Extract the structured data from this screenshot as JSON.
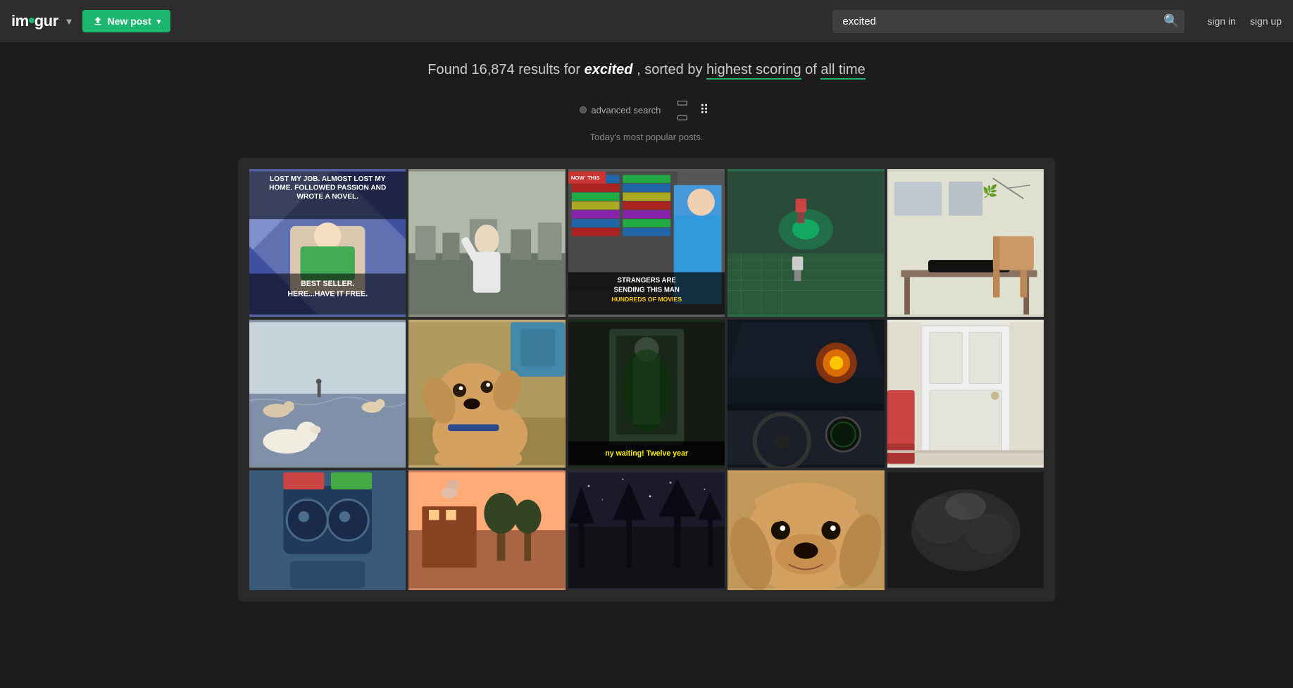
{
  "header": {
    "logo": "imgur",
    "logo_dot": "●",
    "new_post_label": "New post",
    "search_value": "excited",
    "search_placeholder": "Search",
    "sign_in": "sign in",
    "sign_up": "sign up"
  },
  "results": {
    "found_text": "Found 16,874 results for",
    "query": "excited",
    "sorted_by_text": ", sorted by",
    "sort_option": "highest scoring",
    "of_text": "of",
    "time_option": "all time",
    "advanced_search": "advanced search",
    "popular_label": "Today's most popular posts."
  },
  "grid": {
    "rows": [
      [
        {
          "id": "img1",
          "color": "#4a5a9a",
          "overlay_top": "LOST MY JOB. ALMOST LOST MY HOME. FOLLOWED PASSION AND WROTE A NOVEL.",
          "overlay_bottom": "BEST SELLER.\nHERE...HAVE IT FREE.",
          "overlay_pos": "split"
        },
        {
          "id": "img2",
          "color": "#7a8a7a",
          "overlay_top": "",
          "overlay_bottom": "",
          "overlay_pos": "none"
        },
        {
          "id": "img3",
          "color": "#6a6a6a",
          "overlay_top": "",
          "overlay_bottom": "STRANGERS ARE SENDING THIS MAN HUNDREDS OF MOVIES",
          "overlay_pos": "bottom",
          "corner_badge": "NOW THIS"
        },
        {
          "id": "img4",
          "color": "#2a6a4a",
          "overlay_top": "",
          "overlay_bottom": "",
          "overlay_pos": "none"
        },
        {
          "id": "img5",
          "color": "#ccccbb",
          "overlay_top": "",
          "overlay_bottom": "",
          "overlay_pos": "none"
        }
      ],
      [
        {
          "id": "img6",
          "color": "#7a8a9a",
          "overlay_top": "",
          "overlay_bottom": "",
          "overlay_pos": "none"
        },
        {
          "id": "img7",
          "color": "#c8a870",
          "overlay_top": "",
          "overlay_bottom": "",
          "overlay_pos": "none"
        },
        {
          "id": "img8",
          "color": "#3a4a3a",
          "overlay_top": "",
          "overlay_bottom": "ny waiting! Twelve year",
          "overlay_pos": "bottom",
          "overlay_color": "yellow"
        },
        {
          "id": "img9",
          "color": "#1a1a2a",
          "overlay_top": "",
          "overlay_bottom": "",
          "overlay_pos": "none"
        },
        {
          "id": "img10",
          "color": "#e8e8e0",
          "overlay_top": "",
          "overlay_bottom": "",
          "overlay_pos": "none"
        }
      ],
      [
        {
          "id": "img11",
          "color": "#4a6a8a",
          "overlay_top": "",
          "overlay_bottom": "",
          "overlay_pos": "none"
        },
        {
          "id": "img12",
          "color": "#cc8866",
          "overlay_top": "",
          "overlay_bottom": "",
          "overlay_pos": "none"
        },
        {
          "id": "img13",
          "color": "#3a3a4a",
          "overlay_top": "",
          "overlay_bottom": "",
          "overlay_pos": "none"
        },
        {
          "id": "img14",
          "color": "#c8a060",
          "overlay_top": "",
          "overlay_bottom": "",
          "overlay_pos": "none"
        },
        {
          "id": "img15",
          "color": "#2a2a2a",
          "overlay_top": "",
          "overlay_bottom": "",
          "overlay_pos": "none"
        }
      ]
    ]
  }
}
